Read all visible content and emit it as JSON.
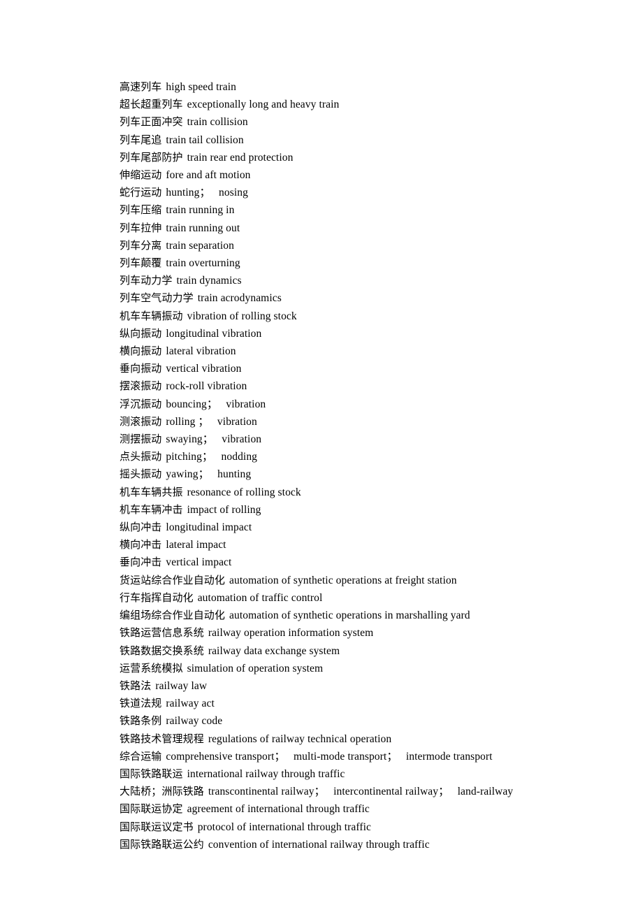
{
  "document": {
    "type": "glossary",
    "language_pair": "Chinese-English",
    "subject": "railway engineering terminology",
    "line_count": 43,
    "background_color": "#ffffff",
    "text_color": "#000000"
  },
  "entries": [
    {
      "cn": "高速列车",
      "en": "high speed train"
    },
    {
      "cn": "超长超重列车",
      "en": "exceptionally long and heavy train"
    },
    {
      "cn": "列车正面冲突",
      "en": "train collision"
    },
    {
      "cn": "列车尾追",
      "en": "train tail collision"
    },
    {
      "cn": "列车尾部防护",
      "en": "train rear end protection"
    },
    {
      "cn": "伸缩运动",
      "en": "fore and aft motion"
    },
    {
      "cn": "蛇行运动",
      "en": "hunting；   nosing"
    },
    {
      "cn": "列车压缩",
      "en": "train running in"
    },
    {
      "cn": "列车拉伸",
      "en": "train running out"
    },
    {
      "cn": "列车分离",
      "en": "train separation"
    },
    {
      "cn": "列车颠覆",
      "en": "train overturning"
    },
    {
      "cn": "列车动力学",
      "en": "train dynamics"
    },
    {
      "cn": "列车空气动力学",
      "en": "train acrodynamics"
    },
    {
      "cn": "机车车辆振动",
      "en": "vibration of rolling stock"
    },
    {
      "cn": "纵向振动",
      "en": "longitudinal vibration"
    },
    {
      "cn": "横向振动",
      "en": "lateral vibration"
    },
    {
      "cn": "垂向振动",
      "en": "vertical vibration"
    },
    {
      "cn": "摆滚振动",
      "en": "rock-roll vibration"
    },
    {
      "cn": "浮沉振动",
      "en": "bouncing；   vibration"
    },
    {
      "cn": "测滚振动",
      "en": "rolling ；   vibration"
    },
    {
      "cn": "测摆振动",
      "en": "swaying；   vibration"
    },
    {
      "cn": "点头振动",
      "en": "pitching；   nodding"
    },
    {
      "cn": "摇头振动",
      "en": "yawing；   hunting"
    },
    {
      "cn": "机车车辆共振",
      "en": "resonance of rolling stock"
    },
    {
      "cn": "机车车辆冲击",
      "en": "impact of rolling"
    },
    {
      "cn": "纵向冲击",
      "en": "longitudinal impact"
    },
    {
      "cn": "横向冲击",
      "en": "lateral impact"
    },
    {
      "cn": "垂向冲击",
      "en": "vertical impact"
    },
    {
      "cn": "货运站综合作业自动化",
      "en": "automation of synthetic operations at freight station"
    },
    {
      "cn": "行车指挥自动化",
      "en": "automation of traffic control"
    },
    {
      "cn": "编组场综合作业自动化",
      "en": "automation of synthetic operations in marshalling yard"
    },
    {
      "cn": "铁路运营信息系统",
      "en": "railway operation information system"
    },
    {
      "cn": "铁路数据交换系统",
      "en": "railway data exchange system"
    },
    {
      "cn": "运营系统模拟",
      "en": "simulation of operation system"
    },
    {
      "cn": "铁路法",
      "en": "railway law"
    },
    {
      "cn": "铁道法规",
      "en": "railway act"
    },
    {
      "cn": "铁路条例",
      "en": "railway code"
    },
    {
      "cn": "铁路技术管理规程",
      "en": "regulations of railway technical operation"
    },
    {
      "cn": "综合运输",
      "en": "comprehensive transport；   multi-mode transport；   intermode transport"
    },
    {
      "cn": "国际铁路联运",
      "en": "international railway through traffic"
    },
    {
      "cn": "大陆桥；洲际铁路",
      "en": "transcontinental railway；   intercontinental railway；   land-railway"
    },
    {
      "cn": "国际联运协定",
      "en": "agreement of international through traffic"
    },
    {
      "cn": "国际联运议定书",
      "en": "protocol of international through traffic"
    },
    {
      "cn": "国际铁路联运公约",
      "en": "convention of international railway through traffic"
    }
  ]
}
